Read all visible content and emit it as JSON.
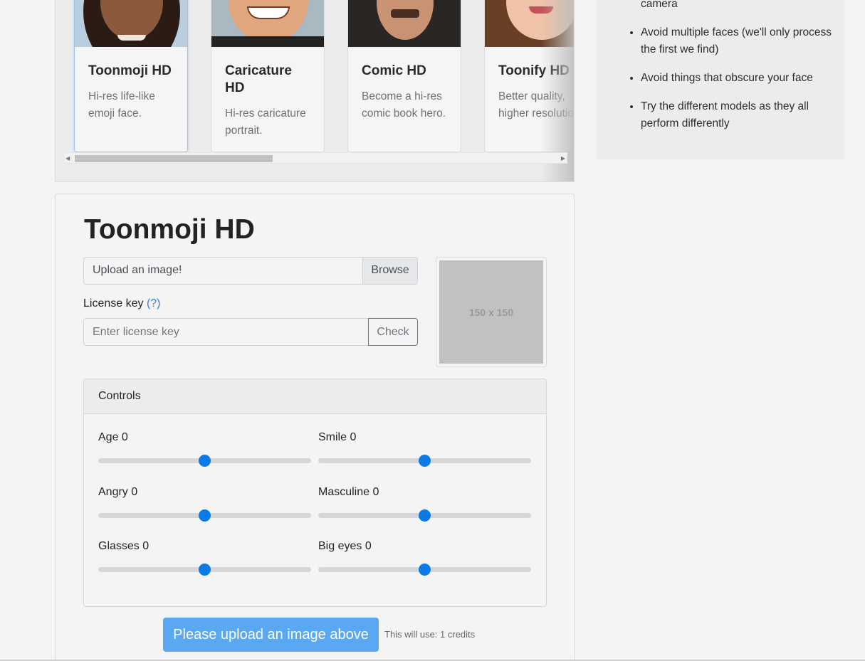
{
  "models": [
    {
      "title": "Toonmoji HD",
      "desc": "Hi-res life-like emoji face.",
      "selected": true
    },
    {
      "title": "Caricature HD",
      "desc": "Hi-res caricature portrait.",
      "selected": false
    },
    {
      "title": "Comic HD",
      "desc": "Become a hi-res comic book hero.",
      "selected": false
    },
    {
      "title": "Toonify HD",
      "desc": "Better quality, higher resolution.",
      "selected": false
    }
  ],
  "tips": [
    "camera",
    "Avoid multiple faces (we'll only process the first we find)",
    "Avoid things that obscure your face",
    "Try the different models as they all perform differently"
  ],
  "main": {
    "title": "Toonmoji HD",
    "upload_label": "Upload an image!",
    "browse_label": "Browse",
    "license_label": "License key",
    "license_help": "(?)",
    "license_placeholder": "Enter license key",
    "check_label": "Check",
    "preview_placeholder": "150 x 150",
    "controls_title": "Controls",
    "sliders": [
      {
        "label": "Age 0",
        "value": 0
      },
      {
        "label": "Smile 0",
        "value": 0
      },
      {
        "label": "Angry 0",
        "value": 0
      },
      {
        "label": "Masculine 0",
        "value": 0
      },
      {
        "label": "Glasses 0",
        "value": 0
      },
      {
        "label": "Big eyes 0",
        "value": 0
      }
    ],
    "submit_label": "Please upload an image above",
    "credits_text": "This will use: 1 credits"
  },
  "colors": {
    "accent": "#0b79e6",
    "submit": "#5aa8f2"
  }
}
